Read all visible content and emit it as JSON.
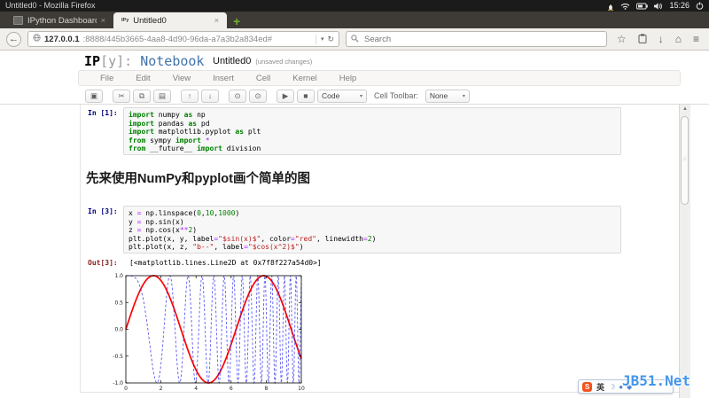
{
  "desktop": {
    "window_title": "Untitled0 - Mozilla Firefox",
    "clock": "15:26",
    "tray_icons": [
      "linux-penguin",
      "wifi",
      "battery",
      "volume",
      "power"
    ]
  },
  "browser": {
    "tabs": [
      {
        "label": "IPython Dashboard",
        "close": "×"
      },
      {
        "label": "Untitled0",
        "favicon": "IPy",
        "close": "×"
      }
    ],
    "new_tab": "+",
    "back": "←",
    "url_host": "127.0.0.1",
    "url_rest": ":8888/445b3665-4aa8-4d90-96da-a7a3b2a834ed#",
    "reload": "↻",
    "search_placeholder": "Search"
  },
  "notebook": {
    "logo_ip": "IP",
    "logo_y": "[y]:",
    "logo_name": "Notebook",
    "title": "Untitled0",
    "status": "(unsaved changes)",
    "menus": [
      "File",
      "Edit",
      "View",
      "Insert",
      "Cell",
      "Kernel",
      "Help"
    ],
    "toolbar": {
      "buttons": [
        {
          "name": "save-button",
          "icon": "floppy-icon",
          "glyph": "▣",
          "group_after": true
        },
        {
          "name": "cut-cell-button",
          "icon": "scissors-icon",
          "glyph": "✂"
        },
        {
          "name": "copy-cell-button",
          "icon": "copy-icon",
          "glyph": "⧉"
        },
        {
          "name": "paste-cell-button",
          "icon": "clipboard-icon",
          "glyph": "▤",
          "group_after": true
        },
        {
          "name": "move-cell-up-button",
          "icon": "arrow-up-icon",
          "glyph": "↑"
        },
        {
          "name": "move-cell-down-button",
          "icon": "arrow-down-icon",
          "glyph": "↓",
          "group_after": true
        },
        {
          "name": "select-prev-cell-button",
          "icon": "circle-arrow-up-icon",
          "glyph": "⊙"
        },
        {
          "name": "select-next-cell-button",
          "icon": "circle-arrow-down-icon",
          "glyph": "⊙",
          "group_after": true
        },
        {
          "name": "run-cell-button",
          "icon": "play-icon",
          "glyph": "▶"
        },
        {
          "name": "interrupt-kernel-button",
          "icon": "stop-icon",
          "glyph": "■"
        }
      ],
      "celltype_value": "Code",
      "cell_toolbar_label": "Cell Toolbar:",
      "cell_toolbar_value": "None"
    },
    "heading": "先来使用NumPy和pyplot画个简单的图",
    "cells": {
      "in1": {
        "prompt": "In [1]:",
        "lines": [
          [
            {
              "t": "k",
              "s": "import"
            },
            {
              "t": "p",
              "s": " numpy "
            },
            {
              "t": "k",
              "s": "as"
            },
            {
              "t": "p",
              "s": " np"
            }
          ],
          [
            {
              "t": "k",
              "s": "import"
            },
            {
              "t": "p",
              "s": " pandas "
            },
            {
              "t": "k",
              "s": "as"
            },
            {
              "t": "p",
              "s": " pd"
            }
          ],
          [
            {
              "t": "k",
              "s": "import"
            },
            {
              "t": "p",
              "s": " matplotlib.pyplot "
            },
            {
              "t": "k",
              "s": "as"
            },
            {
              "t": "p",
              "s": " plt"
            }
          ],
          [
            {
              "t": "k",
              "s": "from"
            },
            {
              "t": "p",
              "s": " sympy "
            },
            {
              "t": "k",
              "s": "import"
            },
            {
              "t": "p",
              "s": " "
            },
            {
              "t": "o",
              "s": "*"
            }
          ],
          [
            {
              "t": "k",
              "s": "from"
            },
            {
              "t": "p",
              "s": " __future__ "
            },
            {
              "t": "k",
              "s": "import"
            },
            {
              "t": "p",
              "s": " division"
            }
          ]
        ]
      },
      "in3": {
        "prompt": "In [3]:",
        "lines": [
          [
            {
              "t": "p",
              "s": "x "
            },
            {
              "t": "o",
              "s": "="
            },
            {
              "t": "p",
              "s": " np.linspace("
            },
            {
              "t": "n",
              "s": "0"
            },
            {
              "t": "p",
              "s": ","
            },
            {
              "t": "n",
              "s": "10"
            },
            {
              "t": "p",
              "s": ","
            },
            {
              "t": "n",
              "s": "1000"
            },
            {
              "t": "p",
              "s": ")"
            }
          ],
          [
            {
              "t": "p",
              "s": "y "
            },
            {
              "t": "o",
              "s": "="
            },
            {
              "t": "p",
              "s": " np.sin(x)"
            }
          ],
          [
            {
              "t": "p",
              "s": "z "
            },
            {
              "t": "o",
              "s": "="
            },
            {
              "t": "p",
              "s": " np.cos(x"
            },
            {
              "t": "o",
              "s": "**"
            },
            {
              "t": "n",
              "s": "2"
            },
            {
              "t": "p",
              "s": ")"
            }
          ],
          [
            {
              "t": "p",
              "s": "plt.plot(x, y, label"
            },
            {
              "t": "o",
              "s": "="
            },
            {
              "t": "s",
              "s": "\"$sin(x)$\""
            },
            {
              "t": "p",
              "s": ", color"
            },
            {
              "t": "o",
              "s": "="
            },
            {
              "t": "s",
              "s": "\"red\""
            },
            {
              "t": "p",
              "s": ", linewidth"
            },
            {
              "t": "o",
              "s": "="
            },
            {
              "t": "n",
              "s": "2"
            },
            {
              "t": "p",
              "s": ")"
            }
          ],
          [
            {
              "t": "p",
              "s": "plt.plot(x, z, "
            },
            {
              "t": "s",
              "s": "\"b--\""
            },
            {
              "t": "p",
              "s": ", label"
            },
            {
              "t": "o",
              "s": "="
            },
            {
              "t": "s",
              "s": "\"$cos(x^2)$\""
            },
            {
              "t": "p",
              "s": ")"
            }
          ]
        ]
      },
      "out3": {
        "prompt": "Out[3]:",
        "text": "[<matplotlib.lines.Line2D at 0x7f8f227a54d0>]"
      }
    }
  },
  "chart_data": {
    "type": "line",
    "title": "",
    "xlabel": "",
    "ylabel": "",
    "xlim": [
      0,
      10
    ],
    "ylim": [
      -1.0,
      1.0
    ],
    "xticks": [
      0,
      2,
      4,
      6,
      8,
      10
    ],
    "yticks": [
      -1.0,
      -0.5,
      0.0,
      0.5,
      1.0
    ],
    "grid": false,
    "legend": "none",
    "frame": "box",
    "n_points": 1000,
    "series": [
      {
        "name": "$sin(x)$",
        "fn": "sin(x)",
        "color": "red",
        "linestyle": "solid",
        "linewidth": 2
      },
      {
        "name": "$cos(x^2)$",
        "fn": "cos(x^2)",
        "color": "#2222ee",
        "linestyle": "dashed",
        "linewidth": 1
      }
    ]
  },
  "ime": {
    "logo": "S",
    "mode": "英",
    "icons": [
      "moon-icon",
      "pen-icon",
      "keyboard-icon"
    ],
    "icon_glyphs": [
      "☽",
      "●",
      "◆"
    ]
  },
  "watermark": "JB51.Net",
  "colors": {
    "prompt_in": "#000080",
    "prompt_out": "#8b2020",
    "keyword": "#008000",
    "number": "#008000",
    "string": "#BA2121",
    "operator": "#AA22FF",
    "logo_blue": "#4173a9",
    "new_tab_green": "#6cb52d",
    "watermark_blue": "#4396ea",
    "cell_bg": "#f7f7f7"
  }
}
